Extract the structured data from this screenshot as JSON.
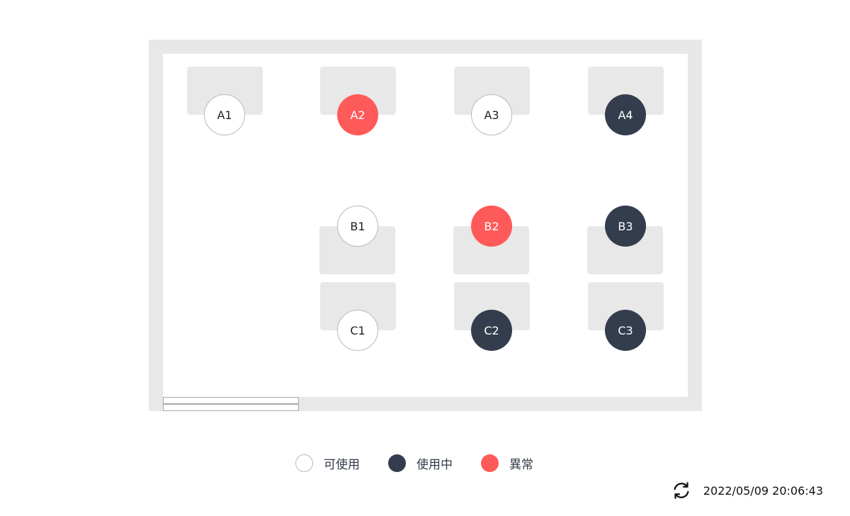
{
  "seats": [
    {
      "label": "A1",
      "status": "available"
    },
    {
      "label": "A2",
      "status": "error"
    },
    {
      "label": "A3",
      "status": "available"
    },
    {
      "label": "A4",
      "status": "in_use"
    },
    {
      "label": "B1",
      "status": "available"
    },
    {
      "label": "B2",
      "status": "error"
    },
    {
      "label": "B3",
      "status": "in_use"
    },
    {
      "label": "C1",
      "status": "available"
    },
    {
      "label": "C2",
      "status": "in_use"
    },
    {
      "label": "C3",
      "status": "in_use"
    }
  ],
  "legend": {
    "available": "可使用",
    "in_use": "使用中",
    "error": "異常"
  },
  "footer": {
    "refresh_icon": "refresh-icon",
    "timestamp": "2022/05/09 20:06:43"
  },
  "colors": {
    "available": "#ffffff",
    "in_use": "#343d4d",
    "error": "#ff5a5a",
    "wall": "#e8e8e8"
  }
}
